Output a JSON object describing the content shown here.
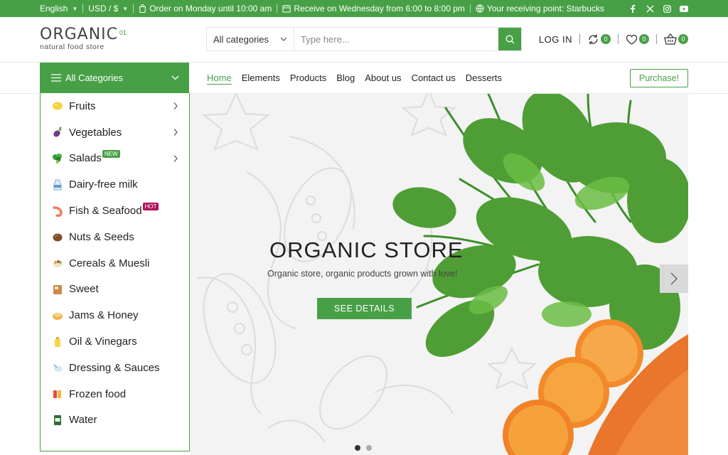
{
  "topbar": {
    "language": "English",
    "currency": "USD / $",
    "order_note": "Order on Monday until 10:00 am",
    "receive_note": "Receive on Wednesday from 6:00 to 8:00 pm",
    "pickup_note": "Your receiving point: Starbucks",
    "social_icons": [
      "facebook-icon",
      "x-twitter-icon",
      "instagram-icon",
      "youtube-icon"
    ]
  },
  "header": {
    "logo_name": "ORGANIC",
    "logo_sup": "01",
    "logo_tagline": "natural food store",
    "search_category": "All categories",
    "search_placeholder": "Type here...",
    "login": "LOG IN",
    "compare_count": "0",
    "wishlist_count": "0",
    "cart_count": "0"
  },
  "nav": {
    "all_categories": "All Categories",
    "items": [
      "Home",
      "Elements",
      "Products",
      "Blog",
      "About us",
      "Contact us",
      "Desserts"
    ],
    "active": "Home",
    "purchase": "Purchase!"
  },
  "sidebar": {
    "items": [
      {
        "label": "Fruits",
        "icon": "lemon-icon",
        "arrow": true
      },
      {
        "label": "Vegetables",
        "icon": "eggplant-icon",
        "arrow": true
      },
      {
        "label": "Salads",
        "icon": "broccoli-icon",
        "arrow": true,
        "tag": "NEW"
      },
      {
        "label": "Dairy-free milk",
        "icon": "milk-icon",
        "arrow": false
      },
      {
        "label": "Fish & Seafood",
        "icon": "shrimp-icon",
        "arrow": false,
        "tag": "HOT"
      },
      {
        "label": "Nuts & Seeds",
        "icon": "nut-icon",
        "arrow": false
      },
      {
        "label": "Cereals & Muesli",
        "icon": "cereal-bowl-icon",
        "arrow": false
      },
      {
        "label": "Sweet",
        "icon": "candy-icon",
        "arrow": false
      },
      {
        "label": "Jams & Honey",
        "icon": "honey-icon",
        "arrow": false
      },
      {
        "label": "Oil & Vinegars",
        "icon": "oil-bottle-icon",
        "arrow": false
      },
      {
        "label": "Dressing & Sauces",
        "icon": "sauce-icon",
        "arrow": false
      },
      {
        "label": "Frozen food",
        "icon": "frozen-icon",
        "arrow": false
      },
      {
        "label": "Water",
        "icon": "water-bottle-icon",
        "arrow": false
      }
    ]
  },
  "hero": {
    "title": "ORGANIC STORE",
    "subtitle": "Organic store, organic products grown with love!",
    "button": "SEE DETAILS"
  },
  "colors": {
    "brand_green": "#48a046",
    "new_tag": "#48a046",
    "hot_tag": "#b0125b"
  }
}
